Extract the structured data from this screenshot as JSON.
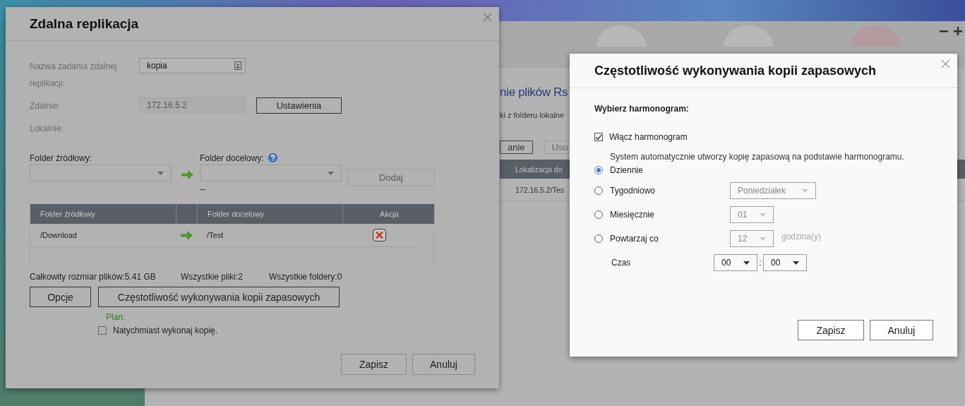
{
  "background_window": {
    "heading": "nie plików Rs",
    "description": "ki z folderu lokalne",
    "buttons": [
      "anie",
      "Usu"
    ],
    "table": {
      "columns": [
        "Lokalizacja do"
      ],
      "rows": [
        [
          "172.16.5.2/Tes"
        ]
      ]
    }
  },
  "replication_dialog": {
    "title": "Zdalna replikacja",
    "task_name": {
      "label": "Nazwa zadania zdalnej replikacji:",
      "value": "kopia"
    },
    "remote": {
      "label": "Zdalnie:",
      "value": "172.16.5.2",
      "button": "Ustawienia"
    },
    "local": {
      "label": "Lokalnie:"
    },
    "source_folder": {
      "label": "Folder źródłowy:"
    },
    "target_folder": {
      "label": "Folder docelowy:",
      "note": "--"
    },
    "add_button": {
      "label": "Dodaj",
      "disabled": true
    },
    "table": {
      "columns": [
        "Folder źródłowy",
        "Folder docelowy",
        "Akcja"
      ],
      "rows": [
        {
          "source": "/Download",
          "target": "/Test"
        }
      ]
    },
    "summary": [
      "Całkowity rozmiar plików:5.41 GB",
      "Wszystkie pliki:2",
      "Wszystkie foldery:0"
    ],
    "options_button": "Opcje",
    "schedule_button": "Częstotliwość wykonywania kopii zapasowych",
    "plan_label": "Plan:",
    "immediate": {
      "label": "Natychmiast wykonaj kopię.",
      "checked": false
    },
    "buttons": [
      "Zapisz",
      "Anuluj"
    ]
  },
  "schedule_dialog": {
    "title": "Częstotliwość wykonywania kopii zapasowych",
    "section_label": "Wybierz harmonogram:",
    "enable": {
      "label": "Włącz harmonogram",
      "checked": true
    },
    "note": "System automatycznie utworzy kopię zapasową na podstawie harmonogramu.",
    "options": [
      {
        "label": "Dziennie",
        "selected": true
      },
      {
        "label": "Tygodniowo",
        "selected": false,
        "select": {
          "value": "Poniedziałek",
          "disabled": true
        }
      },
      {
        "label": "Miesięcznie",
        "selected": false,
        "select": {
          "value": "01",
          "disabled": true
        }
      },
      {
        "label": "Powtarzaj co",
        "selected": false,
        "select": {
          "value": "12",
          "disabled": true
        },
        "unit": "godzina(y)"
      }
    ],
    "time": {
      "label": "Czas",
      "hour": {
        "value": "00",
        "disabled": false
      },
      "separator": ":",
      "minute": {
        "value": "00",
        "disabled": false
      }
    },
    "buttons": [
      "Zapisz",
      "Anuluj"
    ]
  }
}
